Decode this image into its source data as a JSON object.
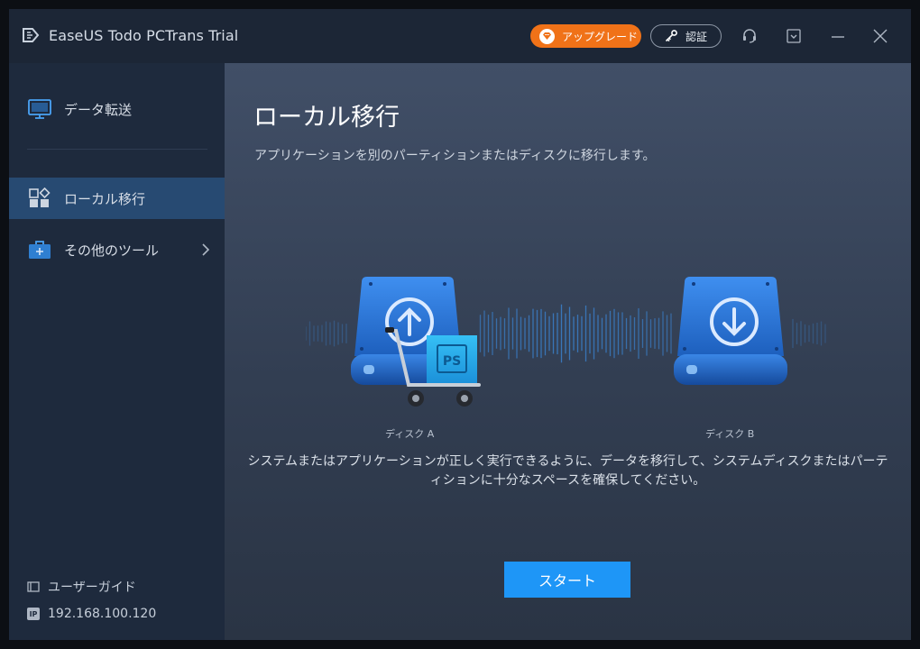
{
  "app": {
    "title": "EaseUS Todo PCTrans Trial",
    "upgrade_label": "アップグレード",
    "activate_label": "認証"
  },
  "sidebar": {
    "items": [
      {
        "label": "データ転送",
        "icon": "monitor-icon"
      },
      {
        "label": "ローカル移行",
        "icon": "apps-grid-icon",
        "active": true
      },
      {
        "label": "その他のツール",
        "icon": "toolbox-icon",
        "has_submenu": true
      }
    ],
    "footer": {
      "guide_label": "ユーザーガイド",
      "ip_badge": "IP",
      "ip_address": "192.168.100.120"
    }
  },
  "main": {
    "title": "ローカル移行",
    "description": "アプリケーションを別のパーティションまたはディスクに移行します。",
    "disk_a_label": "ディスク A",
    "disk_b_label": "ディスク B",
    "cart_box_label": "PS",
    "notice": "システムまたはアプリケーションが正しく実行できるように、データを移行して、システムディスクまたはパーティションに十分なスペースを確保してください。",
    "start_label": "スタート"
  },
  "colors": {
    "accent_blue": "#1e96f7",
    "upgrade_orange": "#f07218",
    "active_nav": "#274a72",
    "sidebar_bg": "#1e2a3d",
    "titlebar_bg": "#1c2636"
  }
}
